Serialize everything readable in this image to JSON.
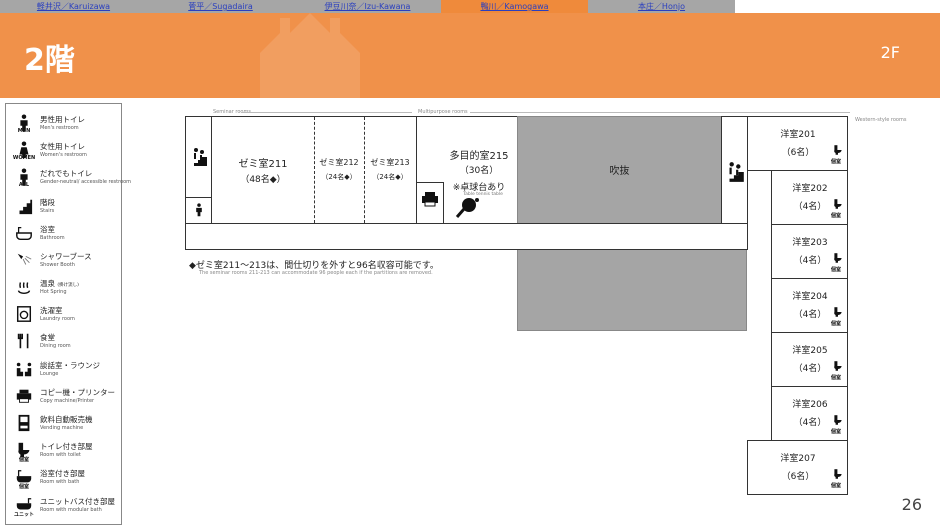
{
  "tabs": [
    {
      "label": "軽井沢／Karuizawa",
      "active": false
    },
    {
      "label": "菅平／Sugadaira",
      "active": false
    },
    {
      "label": "伊豆川奈／Izu-Kawana",
      "active": false
    },
    {
      "label": "鴨川／Kamogawa",
      "active": true
    },
    {
      "label": "本庄／Honjo",
      "active": false
    }
  ],
  "header": {
    "title": "2階",
    "floor": "2F"
  },
  "legend": [
    {
      "jp": "男性用トイレ",
      "en": "Men's restroom",
      "sub": "MEN",
      "icon": "men-icon"
    },
    {
      "jp": "女性用トイレ",
      "en": "Women's restroom",
      "sub": "WOMEN",
      "icon": "women-icon"
    },
    {
      "jp": "だれでもトイレ",
      "en": "Gender-neutral/ accessible restroom",
      "sub": "ALL",
      "icon": "all-gender-icon"
    },
    {
      "jp": "階段",
      "en": "Stairs",
      "sub": "",
      "icon": "stairs-icon"
    },
    {
      "jp": "浴室",
      "en": "Bathroom",
      "sub": "",
      "icon": "bathtub-icon"
    },
    {
      "jp": "シャワーブース",
      "en": "Shower Booth",
      "sub": "",
      "icon": "shower-icon"
    },
    {
      "jp": "温泉",
      "en": "Hot Spring",
      "sub": "",
      "icon": "hot-spring-icon",
      "jp_small": "(掛け流し)"
    },
    {
      "jp": "洗濯室",
      "en": "Laundry room",
      "sub": "",
      "icon": "laundry-icon"
    },
    {
      "jp": "食堂",
      "en": "Dining room",
      "sub": "",
      "icon": "dining-icon"
    },
    {
      "jp": "談話室・ラウンジ",
      "en": "Lounge",
      "sub": "",
      "icon": "lounge-icon"
    },
    {
      "jp": "コピー機・プリンター",
      "en": "Copy machine/Printer",
      "sub": "",
      "icon": "printer-icon"
    },
    {
      "jp": "飲料自動販売機",
      "en": "Vending machine",
      "sub": "",
      "icon": "vending-machine-icon"
    },
    {
      "jp": "トイレ付き部屋",
      "en": "Room with toilet",
      "sub": "個室",
      "icon": "toilet-room-icon"
    },
    {
      "jp": "浴室付き部屋",
      "en": "Room with bath",
      "sub": "個室",
      "icon": "bath-room-icon"
    },
    {
      "jp": "ユニットバス付き部屋",
      "en": "Room with modular bath",
      "sub": "ユニット",
      "icon": "unit-bath-room-icon"
    }
  ],
  "plan": {
    "seminar_caption": "Seminar rooms",
    "multipurpose_caption": "Multipurpose rooms",
    "western_caption": "Western-style rooms",
    "room211": {
      "name": "ゼミ室211",
      "cap": "（48名◆）"
    },
    "room212": {
      "name": "ゼミ室212",
      "cap": "（24名◆）"
    },
    "room213": {
      "name": "ゼミ室213",
      "cap": "（24名◆）"
    },
    "room215": {
      "name": "多目的室215",
      "cap": "（30名）",
      "note": "※卓球台あり",
      "note_en": "Table tennis table"
    },
    "atrium": "吹抜",
    "western": [
      {
        "name": "洋室201",
        "cap": "（6名）"
      },
      {
        "name": "洋室202",
        "cap": "（4名）"
      },
      {
        "name": "洋室203",
        "cap": "（4名）"
      },
      {
        "name": "洋室204",
        "cap": "（4名）"
      },
      {
        "name": "洋室205",
        "cap": "（4名）"
      },
      {
        "name": "洋室206",
        "cap": "（4名）"
      },
      {
        "name": "洋室207",
        "cap": "（6名）"
      }
    ],
    "private_tag": "個室",
    "note": "◆ゼミ室211～213は、間仕切りを外すと96名収容可能です。",
    "note_en": "The seminar rooms 211-213 can accommodate 96 people each if the partitions are removed."
  },
  "page_number": "26",
  "colors": {
    "accent": "#f0914a",
    "tab_active": "#ef8a3b",
    "tab_bar": "#a6a6a6",
    "atrium": "#a5a5a5"
  }
}
